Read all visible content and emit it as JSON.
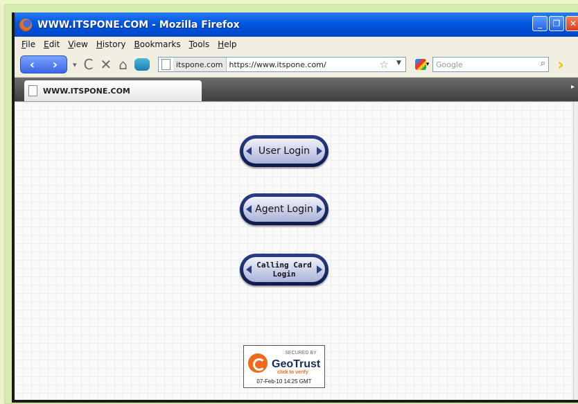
{
  "window": {
    "title": "WWW.ITSPONE.COM - Mozilla Firefox",
    "controls": {
      "minimize": "_",
      "maximize": "❐",
      "close": "✕"
    }
  },
  "menubar": {
    "items": [
      {
        "label": "File"
      },
      {
        "label": "Edit"
      },
      {
        "label": "View"
      },
      {
        "label": "History"
      },
      {
        "label": "Bookmarks"
      },
      {
        "label": "Tools"
      },
      {
        "label": "Help"
      }
    ]
  },
  "toolbar": {
    "back_icon": "back-arrow-icon",
    "forward_icon": "forward-arrow-icon",
    "site_identity": "itspone.com",
    "url": "https://www.itspone.com/",
    "search_placeholder": "Google"
  },
  "tabs": [
    {
      "label": "WWW.ITSPONE.COM",
      "active": true
    }
  ],
  "page": {
    "buttons": [
      {
        "label": "User Login"
      },
      {
        "label": "Agent Login"
      },
      {
        "label": "Calling Card Login"
      }
    ],
    "seal": {
      "secured_by": "SECURED BY",
      "brand": "GeoTrust",
      "verify": "click to verify",
      "date": "07-Feb-10 14:25 GMT"
    }
  },
  "colors": {
    "titlebar": "#0056e0",
    "chrome": "#f1efe2",
    "button_border": "#2b3e86"
  }
}
